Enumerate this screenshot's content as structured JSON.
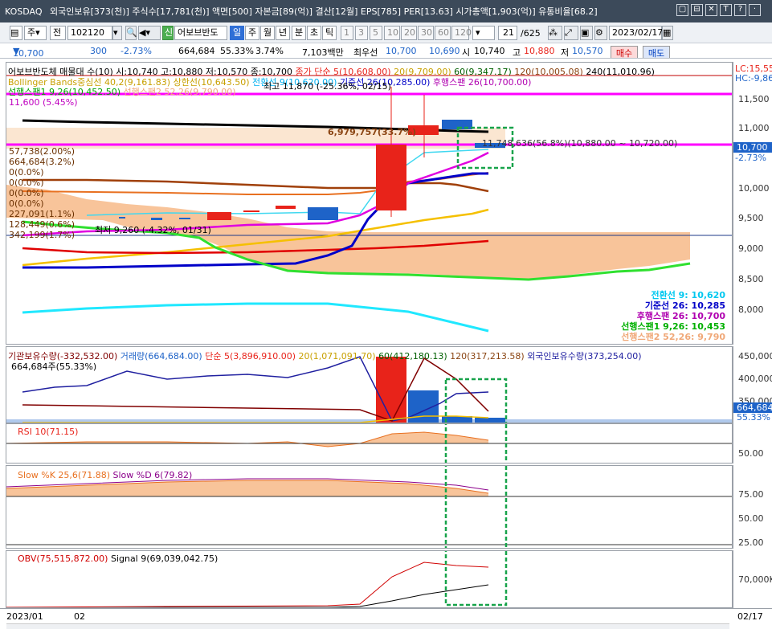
{
  "titlebar": {
    "market": "KOSDAQ",
    "text": "외국인보유[373(천)] 주식수[17,781(천)] 액면[500] 자본금[89(억)] 결산[12월] EPS[785] PER[13.63] 시가총액[1,903(억)] 유통비율[68.2]",
    "controls": [
      "▢",
      "⊟",
      "✕",
      "T",
      "?",
      "·"
    ]
  },
  "toolbar": {
    "period_mode": "주",
    "range_label": "전",
    "stock_code": "102120",
    "stock_name": "어보브반도",
    "period_buttons": [
      "일",
      "주",
      "월",
      "년",
      "분",
      "초",
      "틱"
    ],
    "selected_period": "일",
    "interval_buttons": [
      "1",
      "3",
      "5",
      "10",
      "20",
      "30",
      "60",
      "120"
    ],
    "count": "21",
    "count_total": "/625",
    "date": "2023/02/17"
  },
  "quote": {
    "price": "10,700",
    "change": "300",
    "change_rate": "-2.73%",
    "volume": "664,684",
    "ratio": "55.33%",
    "turnover": "3.74%",
    "amount": "7,103백만",
    "best_ask_label": "최우선",
    "best_ask": "10,700",
    "best_bid": "10,690",
    "open_label": "시",
    "open": "10,740",
    "high_label": "고",
    "high": "10,880",
    "low_label": "저",
    "low": "10,570",
    "buy_button": "매수",
    "sell_button": "매도"
  },
  "price_pane": {
    "legend1_name": "어보브반도체 매물대 수(10)",
    "legend1_ohlc": "시:10,740 고:10,880 저:10,570 종:10,700",
    "legend1_ma": "종가 단순 5(10,608.00)",
    "legend1_ma20": "20(9,709.00)",
    "legend1_ma60": "60(9,347.17)",
    "legend1_ma120": "120(10,005.08)",
    "legend1_ma240": "240(11,010.96)",
    "legend2_bb": "Bollinger Bands중심선 40,2(9,161.83)",
    "legend2_bb_up": "상한선(10,643.50)",
    "legend2_conv": "전환선 9(10,620.00)",
    "legend2_base": "기준선 26(10,285.00)",
    "legend2_lag": "후행스팬 26(10,700.00)",
    "legend3_span1": "선행스팬1 9,26(10,452.50)",
    "legend3_span2": "선행스팬2 52,26(9,790.00)",
    "max_note": "최고 11,870 (-25.36%, 02/15)",
    "min_note": "최저 9,260 (-4.32%, 01/31)",
    "pct_label": "11,600 (5.45%)",
    "vol_profile_top": "6,979,757(33.7%)",
    "vol_profile_current": "11,748,636(56.8%)(10,880.00 ~ 10,720.00)",
    "left_labels": [
      "57,738(2.00%)",
      "664,684(3.2%)",
      "0(0.0%)",
      "0(0.0%)",
      "0(0.0%)",
      "0(0.0%)",
      "227,091(1.1%)",
      "128,449(0.6%)",
      "342,199(1.7%)"
    ],
    "lc_label": "LC:15,55",
    "hc_label": "HC:-9,86",
    "current_price_tag": "10,700",
    "current_change_tag": "-2.73%",
    "y_ticks": [
      "11,500",
      "11,000",
      "10,500",
      "10,000",
      "9,500",
      "9,000",
      "8,500",
      "8,000"
    ],
    "ichimoku_summary": [
      {
        "label": "전환선 9: 10,620",
        "color": "#00c8f0"
      },
      {
        "label": "기준선 26: 10,285",
        "color": "#0000c8"
      },
      {
        "label": "후행스팬 26: 10,700",
        "color": "#b000b0"
      },
      {
        "label": "선행스팬1 9,26: 10,453",
        "color": "#00b000"
      },
      {
        "label": "선행스팬2 52,26: 9,790",
        "color": "#f0a878"
      }
    ]
  },
  "volume_pane": {
    "legend_inst": "기관보유수량(-332,532.00)",
    "legend_vol": "거래량(664,684.00)",
    "legend_ma5": "단순 5(3,896,910.00)",
    "legend_ma20": "20(1,071,091.70)",
    "legend_ma60": "60(412,180.13)",
    "legend_ma120": "120(317,213.58)",
    "legend_foreign": "외국인보유수량(373,254.00)",
    "sub_label": "664,684주(55.33%)",
    "y_ticks": [
      "450,000",
      "400,000",
      "350,000"
    ],
    "current_tag": "664,684",
    "current_pct": "55.33%"
  },
  "rsi_pane": {
    "legend": "RSI 10(71.15)",
    "y_ticks": [
      "50.00"
    ]
  },
  "slow_pane": {
    "legend_k": "Slow %K 25,6(71.88)",
    "legend_d": "Slow %D 6(79.82)",
    "y_ticks": [
      "75.00",
      "50.00",
      "25.00"
    ]
  },
  "obv_pane": {
    "legend_obv": "OBV(75,515,872.00)",
    "legend_signal": "Signal 9(69,039,042.75)",
    "y_ticks": [
      "70,000K"
    ]
  },
  "date_axis": {
    "start": "2023/01",
    "mid": "02",
    "end": "02/17"
  },
  "colors": {
    "up": "#e8231a",
    "down": "#1e63c8",
    "magenta": "#ff00ff",
    "highlight": "#17a34a"
  }
}
